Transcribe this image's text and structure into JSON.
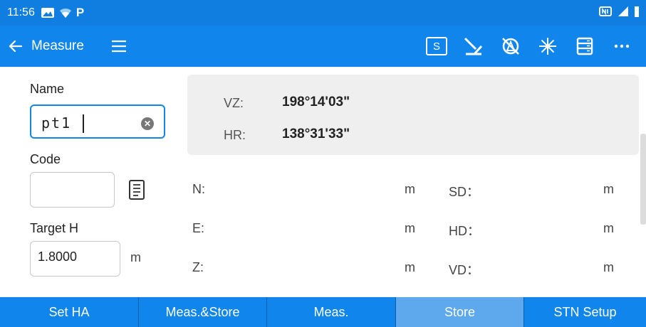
{
  "status_bar": {
    "time": "11:56",
    "icons": [
      "gallery-icon",
      "wifi-icon",
      "p-app-icon",
      "nfc-icon",
      "signal-icon",
      "battery-icon"
    ],
    "p_letter": "P"
  },
  "toolbar": {
    "back_icon": "arrow-left-icon",
    "title": "Measure",
    "menu_icon": "hamburger-icon",
    "s_button_label": "S",
    "actions": [
      "laser-icon",
      "prism-off-icon",
      "star-icon",
      "list-icon",
      "more-icon"
    ]
  },
  "left_panel": {
    "name_label": "Name",
    "name_value": "pt1",
    "code_label": "Code",
    "code_value": "",
    "target_h_label": "Target H",
    "target_h_value": "1.8000",
    "target_h_unit": "m"
  },
  "angles": {
    "vz_label": "VZ:",
    "vz_value": "198°14'03\"",
    "hr_label": "HR:",
    "hr_value": "138°31'33\""
  },
  "results": {
    "n_label": "N:",
    "e_label": "E:",
    "z_label": "Z:",
    "sd_label": "SD：",
    "hd_label": "HD：",
    "vd_label": "VD：",
    "unit": "m"
  },
  "bottom_bar": {
    "buttons": [
      "Set HA",
      "Meas.&Store",
      "Meas.",
      "Store",
      "STN Setup"
    ],
    "active": "Store"
  },
  "colors": {
    "primary": "#1086ec",
    "status_bar": "#0f7ee0",
    "active_button": "#5ea9ee",
    "angle_panel_bg": "#efefef"
  }
}
